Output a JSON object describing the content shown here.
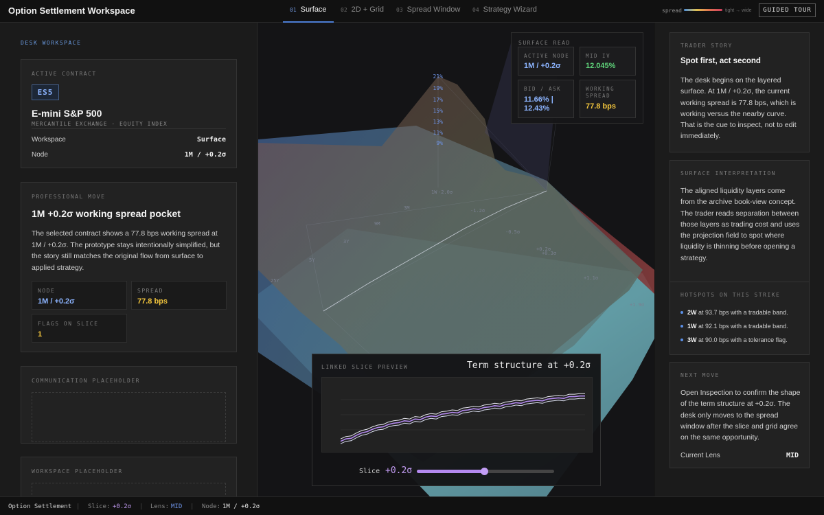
{
  "header": {
    "title": "Option Settlement Workspace",
    "tabs": [
      {
        "num": "01",
        "label": "Surface"
      },
      {
        "num": "02",
        "label": "2D + Grid"
      },
      {
        "num": "03",
        "label": "Spread Window"
      },
      {
        "num": "04",
        "label": "Strategy Wizard"
      }
    ],
    "legend_label": "spread",
    "legend_sub": "tight → wide",
    "guided_tour": "GUIDED TOUR"
  },
  "left": {
    "section": "DESK WORKSPACE",
    "contract": {
      "label": "ACTIVE CONTRACT",
      "badge": "ES5",
      "name": "E-mini S&P 500",
      "exchange": "MERCANTILE EXCHANGE · EQUITY INDEX",
      "workspace_key": "Workspace",
      "workspace_val": "Surface",
      "node_key": "Node",
      "node_val": "1M / +0.2σ"
    },
    "move": {
      "label": "PROFESSIONAL MOVE",
      "title": "1M +0.2σ working spread pocket",
      "body": "The selected contract shows a 77.8 bps working spread at 1M / +0.2σ. The prototype stays intentionally simplified, but the story still matches the original flow from surface to applied strategy.",
      "node_label": "NODE",
      "node_val": "1M / +0.2σ",
      "spread_label": "SPREAD",
      "spread_val": "77.8 bps",
      "flags_label": "FLAGS ON SLICE",
      "flags_val": "1"
    },
    "comm_placeholder": "COMMUNICATION PLACEHOLDER",
    "workspace_placeholder": "WORKSPACE PLACEHOLDER"
  },
  "center": {
    "y_ticks": [
      "21%",
      "19%",
      "17%",
      "15%",
      "13%",
      "11%",
      "9%"
    ],
    "tenors": [
      "25Y",
      "5Y",
      "3Y",
      "9M",
      "3M",
      "1W"
    ],
    "strikes": [
      "-2.0σ",
      "-1.2σ",
      "-0.5σ",
      "+0.2σ",
      "+0.3σ",
      "+1.1σ",
      "+1.9σ"
    ],
    "surface_read": {
      "label": "SURFACE READ",
      "active_node_label": "ACTIVE NODE",
      "active_node_val": "1M / +0.2σ",
      "mid_iv_label": "MID IV",
      "mid_iv_val": "12.045%",
      "bid_ask_label": "BID / ASK",
      "bid_ask_val": "11.66% | 12.43%",
      "working_spread_label": "WORKING SPREAD",
      "working_spread_val": "77.8 bps"
    },
    "preview": {
      "label": "LINKED SLICE PREVIEW",
      "title": "Term structure at +0.2σ",
      "slice_label": "Slice",
      "slice_val": "+0.2σ",
      "slider_level": 0.49
    },
    "colors": {
      "accent": "#4d7fd6",
      "spread": "#f0c33c",
      "iv": "#5fd37a",
      "slice": "#b48af0"
    }
  },
  "chart_data": {
    "type": "line",
    "title": "Term structure at +0.2σ",
    "series": [
      {
        "values": [
          0.1,
          0.14,
          0.15,
          0.2,
          0.24,
          0.26,
          0.3,
          0.33,
          0.34,
          0.38,
          0.4,
          0.41,
          0.44,
          0.43,
          0.47,
          0.46,
          0.5,
          0.52,
          0.51,
          0.55,
          0.56,
          0.58,
          0.57,
          0.61,
          0.62,
          0.64,
          0.63,
          0.66,
          0.67,
          0.69,
          0.68,
          0.71,
          0.72,
          0.74,
          0.73,
          0.76,
          0.77,
          0.78,
          0.77,
          0.8,
          0.81,
          0.82,
          0.81,
          0.84,
          0.84,
          0.85,
          0.85
        ]
      },
      {
        "values": [
          0.06,
          0.1,
          0.11,
          0.16,
          0.2,
          0.22,
          0.26,
          0.29,
          0.3,
          0.34,
          0.36,
          0.37,
          0.4,
          0.39,
          0.43,
          0.42,
          0.46,
          0.48,
          0.47,
          0.51,
          0.52,
          0.54,
          0.53,
          0.57,
          0.58,
          0.6,
          0.59,
          0.62,
          0.63,
          0.65,
          0.64,
          0.67,
          0.68,
          0.7,
          0.69,
          0.72,
          0.73,
          0.74,
          0.73,
          0.76,
          0.77,
          0.78,
          0.77,
          0.8,
          0.8,
          0.81,
          0.81
        ]
      },
      {
        "values": [
          0.02,
          0.06,
          0.07,
          0.12,
          0.16,
          0.18,
          0.22,
          0.25,
          0.26,
          0.3,
          0.32,
          0.33,
          0.36,
          0.35,
          0.39,
          0.38,
          0.42,
          0.44,
          0.43,
          0.47,
          0.48,
          0.5,
          0.49,
          0.53,
          0.54,
          0.56,
          0.55,
          0.58,
          0.59,
          0.61,
          0.6,
          0.63,
          0.64,
          0.66,
          0.65,
          0.68,
          0.69,
          0.7,
          0.69,
          0.72,
          0.73,
          0.74,
          0.73,
          0.76,
          0.76,
          0.77,
          0.77
        ]
      }
    ],
    "ylim": [
      0,
      1
    ],
    "grid": true
  },
  "right": {
    "story": {
      "label": "TRADER STORY",
      "title": "Spot first, act second",
      "body": "The desk begins on the layered surface. At 1M / +0.2σ, the current working spread is 77.8 bps, which is working versus the nearby curve. That is the cue to inspect, not to edit immediately."
    },
    "interp": {
      "label": "SURFACE INTERPRETATION",
      "body": "The aligned liquidity layers come from the archive book-view concept. The trader reads separation between those layers as trading cost and uses the projection field to spot where liquidity is thinning before opening a strategy."
    },
    "hotspots": {
      "label": "HOTSPOTS ON THIS STRIKE",
      "items": [
        {
          "tenor": "2W",
          "text": "at 93.7 bps with a tradable band."
        },
        {
          "tenor": "1W",
          "text": "at 92.1 bps with a tradable band."
        },
        {
          "tenor": "3W",
          "text": "at 90.0 bps with a tolerance flag."
        }
      ]
    },
    "next": {
      "label": "NEXT MOVE",
      "body": "Open Inspection to confirm the shape of the term structure at +0.2σ. The desk only moves to the spread window after the slice and grid agree on the same opportunity.",
      "lens_key": "Current Lens",
      "lens_val": "MID"
    }
  },
  "footer": {
    "app": "Option Settlement",
    "slice_key": "Slice:",
    "slice_val": "+0.2σ",
    "lens_key": "Lens:",
    "lens_val": "MID",
    "node_key": "Node:",
    "node_val": "1M / +0.2σ"
  }
}
